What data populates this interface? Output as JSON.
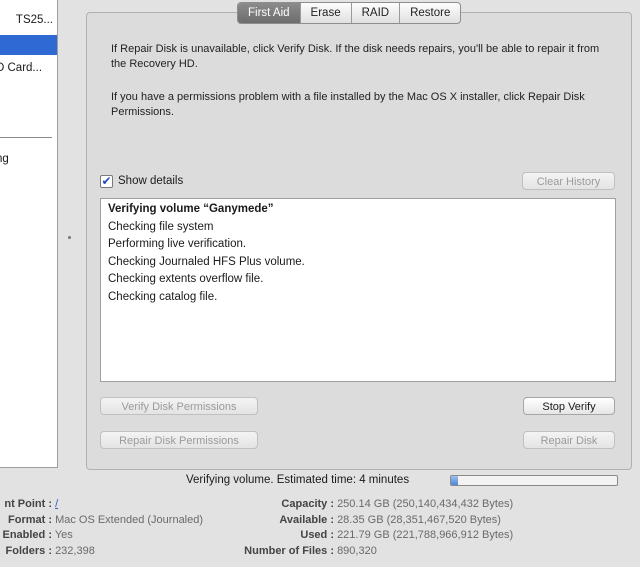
{
  "sidebar": {
    "items": [
      {
        "label": "TS25..."
      },
      {
        "label": ""
      },
      {
        "label": "D Card..."
      },
      {
        "label": "ng"
      }
    ]
  },
  "tabs": [
    {
      "label": "First Aid",
      "active": true
    },
    {
      "label": "Erase",
      "active": false
    },
    {
      "label": "RAID",
      "active": false
    },
    {
      "label": "Restore",
      "active": false
    }
  ],
  "instructions": {
    "p1": "If Repair Disk is unavailable, click Verify Disk. If the disk needs repairs, you'll be able to repair it from the Recovery HD.",
    "p2": "If you have a permissions problem with a file installed by the Mac OS X installer, click Repair Disk Permissions."
  },
  "show_details": {
    "label": "Show details",
    "checked": true
  },
  "buttons": {
    "clear_history": "Clear History",
    "verify_permissions": "Verify Disk Permissions",
    "stop_verify": "Stop Verify",
    "repair_permissions": "Repair Disk Permissions",
    "repair_disk": "Repair Disk"
  },
  "log": [
    "Verifying volume “Ganymede”",
    "Checking file system",
    "Performing live verification.",
    "Checking Journaled HFS Plus volume.",
    "Checking extents overflow file.",
    "Checking catalog file."
  ],
  "progress": {
    "label": "Verifying volume. Estimated time: 4 minutes",
    "fraction": 0.04
  },
  "info_left": [
    {
      "key": "nt Point :",
      "value": "/"
    },
    {
      "key": "Format :",
      "value": "Mac OS Extended (Journaled)"
    },
    {
      "key": "Enabled :",
      "value": "Yes"
    },
    {
      "key": "Folders :",
      "value": "232,398"
    }
  ],
  "info_right": [
    {
      "key": "Capacity :",
      "value": "250.14 GB (250,140,434,432 Bytes)"
    },
    {
      "key": "Available :",
      "value": "28.35 GB (28,351,467,520 Bytes)"
    },
    {
      "key": "Used :",
      "value": "221.79 GB (221,788,966,912 Bytes)"
    },
    {
      "key": "Number of Files :",
      "value": "890,320"
    }
  ],
  "colors": {
    "selection": "#2f6ad4",
    "progress_fill": "#4d86d6"
  }
}
